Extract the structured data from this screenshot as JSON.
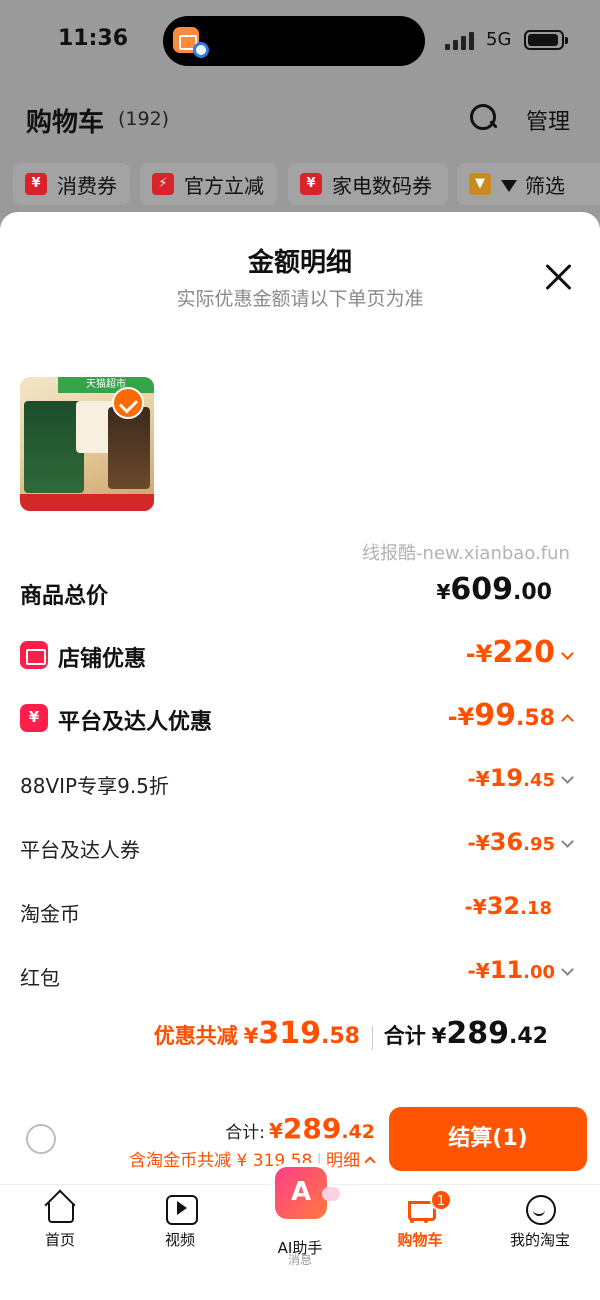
{
  "status_bar": {
    "time": "11:36",
    "network": "5G"
  },
  "header": {
    "title": "购物车",
    "count": "(192)",
    "manage": "管理"
  },
  "chips": [
    {
      "icon": "¥",
      "label": "消费券"
    },
    {
      "icon": "⚡",
      "label": "官方立减"
    },
    {
      "icon": "¥",
      "label": "家电数码券"
    },
    {
      "label": "筛选"
    }
  ],
  "sheet": {
    "title": "金额明细",
    "subtitle": "实际优惠金额请以下单页为准",
    "watermark": "线报酷-new.xianbao.fun",
    "product_image": {
      "banner": "天猫超市"
    }
  },
  "rows": {
    "total_price": {
      "label": "商品总价",
      "sym": "¥",
      "int": "609",
      "dec": ".00"
    },
    "shop_discount": {
      "label": "店铺优惠",
      "sym": "-¥",
      "int": "220",
      "dec": ""
    },
    "platform_discount": {
      "label": "平台及达人优惠",
      "sym": "-¥",
      "int": "99",
      "dec": ".58"
    },
    "vip": {
      "label": "88VIP专享9.5折",
      "sym": "-¥",
      "int": "19",
      "dec": ".45"
    },
    "coupon": {
      "label": "平台及达人券",
      "sym": "-¥",
      "int": "36",
      "dec": ".95"
    },
    "gold_coin": {
      "label": "淘金币",
      "sym": "-¥",
      "int": "32",
      "dec": ".18"
    },
    "red_packet": {
      "label": "红包",
      "sym": "-¥",
      "int": "11",
      "dec": ".00"
    }
  },
  "summary": {
    "save_label": "优惠共减",
    "save_sym": "¥",
    "save_int": "319",
    "save_dec": ".58",
    "total_label": "合计",
    "total_sym": "¥",
    "total_int": "289",
    "total_dec": ".42"
  },
  "checkout": {
    "total_label": "合计:",
    "total_sym": "¥",
    "total_int": "289",
    "total_dec": ".42",
    "sub_text": "含淘金币共减 ¥ 319.58",
    "detail": "明细",
    "button": "结算(1)"
  },
  "tabbar": {
    "home": "首页",
    "video": "视频",
    "ai": "AI助手",
    "ai_sub": "消息",
    "cart": "购物车",
    "cart_badge": "1",
    "me": "我的淘宝"
  },
  "colors": {
    "accent": "#ff5000",
    "button": "#ff5500",
    "badge_red": "#ff1f4a"
  }
}
